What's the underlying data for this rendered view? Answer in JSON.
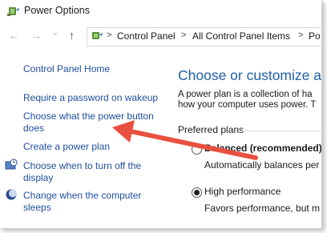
{
  "window": {
    "title": "Power Options",
    "icon": "power-options-icon"
  },
  "nav": {
    "back": "←",
    "forward": "→",
    "dropdown": "⌄",
    "up": "↑",
    "breadcrumbs": [
      "Control Panel",
      "All Control Panel Items",
      "Po"
    ],
    "separator": ">"
  },
  "sidebar": {
    "home": "Control Panel Home",
    "links": [
      {
        "label": "Require a password on wakeup",
        "icon": ""
      },
      {
        "label_line1": "Choose what the power button",
        "label_line2": "does",
        "icon": ""
      },
      {
        "label": "Create a power plan",
        "icon": ""
      },
      {
        "label_line1": "Choose when to turn off the",
        "label_line2": "display",
        "icon": "display-clock-icon"
      },
      {
        "label_line1": "Change when the computer",
        "label_line2": "sleeps",
        "icon": "moon-sleep-icon"
      }
    ]
  },
  "main": {
    "heading": "Choose or customize a po",
    "description_line1": "A power plan is a collection of ha",
    "description_line2": "how your computer uses power. T",
    "preferred_label": "Preferred plans",
    "plans": [
      {
        "name": "Balanced (recommended)",
        "description": "Automatically balances per",
        "selected": false
      },
      {
        "name": "High performance",
        "description": "Favors performance, but m",
        "selected": true
      }
    ]
  },
  "annotation": {
    "color": "#e8513f"
  }
}
